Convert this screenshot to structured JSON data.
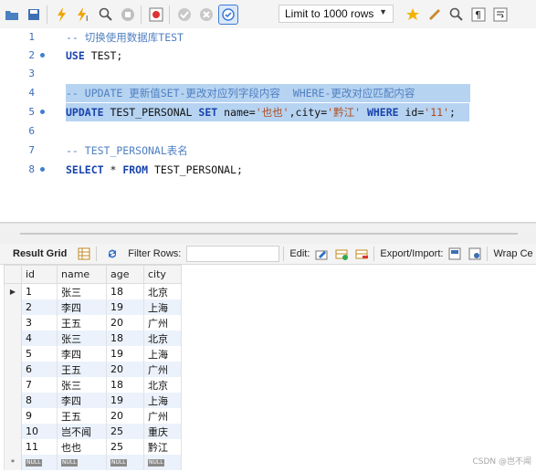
{
  "toolbar": {
    "limit_label": "Limit to 1000 rows"
  },
  "editor": {
    "lines": [
      {
        "num": "1",
        "tokens": [
          {
            "t": "-- 切换使用数据库TEST",
            "c": "cm"
          }
        ]
      },
      {
        "num": "2",
        "tokens": [
          {
            "t": "USE",
            "c": "kw"
          },
          {
            "t": " TEST;",
            "c": "id"
          }
        ]
      },
      {
        "num": "3",
        "tokens": []
      },
      {
        "num": "4",
        "tokens": [
          {
            "t": "-- UPDATE 更新值SET-更改对应列字段内容  WHERE-更改对应匹配内容",
            "c": "cm"
          }
        ]
      },
      {
        "num": "5",
        "tokens": [
          {
            "t": "UPDATE",
            "c": "kw"
          },
          {
            "t": " TEST_PERSONAL ",
            "c": "id"
          },
          {
            "t": "SET",
            "c": "kw"
          },
          {
            "t": " name=",
            "c": "id"
          },
          {
            "t": "'也也'",
            "c": "str"
          },
          {
            "t": ",city=",
            "c": "id"
          },
          {
            "t": "'黔江'",
            "c": "str"
          },
          {
            "t": " ",
            "c": "id"
          },
          {
            "t": "WHERE",
            "c": "kw"
          },
          {
            "t": " id=",
            "c": "id"
          },
          {
            "t": "'11'",
            "c": "str"
          },
          {
            "t": ";",
            "c": "id"
          }
        ]
      },
      {
        "num": "6",
        "tokens": []
      },
      {
        "num": "7",
        "tokens": [
          {
            "t": "-- TEST_PERSONAL表名",
            "c": "cm"
          }
        ]
      },
      {
        "num": "8",
        "tokens": [
          {
            "t": "SELECT",
            "c": "kw"
          },
          {
            "t": " * ",
            "c": "id"
          },
          {
            "t": "FROM",
            "c": "kw"
          },
          {
            "t": " TEST_PERSONAL;",
            "c": "id"
          }
        ]
      }
    ]
  },
  "result_toolbar": {
    "tab_label": "Result Grid",
    "filter_label": "Filter Rows:",
    "edit_label": "Edit:",
    "export_label": "Export/Import:",
    "wrap_label": "Wrap Ce"
  },
  "grid": {
    "columns": [
      "id",
      "name",
      "age",
      "city"
    ],
    "rows": [
      [
        "1",
        "张三",
        "18",
        "北京"
      ],
      [
        "2",
        "李四",
        "19",
        "上海"
      ],
      [
        "3",
        "王五",
        "20",
        "广州"
      ],
      [
        "4",
        "张三",
        "18",
        "北京"
      ],
      [
        "5",
        "李四",
        "19",
        "上海"
      ],
      [
        "6",
        "王五",
        "20",
        "广州"
      ],
      [
        "7",
        "张三",
        "18",
        "北京"
      ],
      [
        "8",
        "李四",
        "19",
        "上海"
      ],
      [
        "9",
        "王五",
        "20",
        "广州"
      ],
      [
        "10",
        "岂不闻",
        "25",
        "重庆"
      ],
      [
        "11",
        "也也",
        "25",
        "黔江"
      ]
    ],
    "null_label": "NULL",
    "new_row_marker": "*"
  },
  "watermark": "CSDN @岂不闻"
}
